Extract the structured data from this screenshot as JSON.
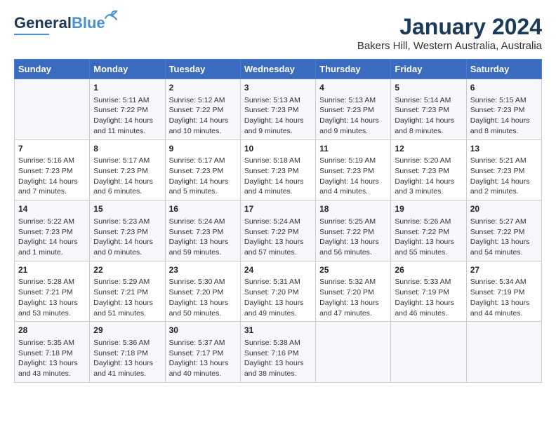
{
  "header": {
    "logo_general": "General",
    "logo_blue": "Blue",
    "main_title": "January 2024",
    "subtitle": "Bakers Hill, Western Australia, Australia"
  },
  "days_of_week": [
    "Sunday",
    "Monday",
    "Tuesday",
    "Wednesday",
    "Thursday",
    "Friday",
    "Saturday"
  ],
  "weeks": [
    [
      {
        "day": "",
        "content": ""
      },
      {
        "day": "1",
        "content": "Sunrise: 5:11 AM\nSunset: 7:22 PM\nDaylight: 14 hours\nand 11 minutes."
      },
      {
        "day": "2",
        "content": "Sunrise: 5:12 AM\nSunset: 7:22 PM\nDaylight: 14 hours\nand 10 minutes."
      },
      {
        "day": "3",
        "content": "Sunrise: 5:13 AM\nSunset: 7:23 PM\nDaylight: 14 hours\nand 9 minutes."
      },
      {
        "day": "4",
        "content": "Sunrise: 5:13 AM\nSunset: 7:23 PM\nDaylight: 14 hours\nand 9 minutes."
      },
      {
        "day": "5",
        "content": "Sunrise: 5:14 AM\nSunset: 7:23 PM\nDaylight: 14 hours\nand 8 minutes."
      },
      {
        "day": "6",
        "content": "Sunrise: 5:15 AM\nSunset: 7:23 PM\nDaylight: 14 hours\nand 8 minutes."
      }
    ],
    [
      {
        "day": "7",
        "content": "Sunrise: 5:16 AM\nSunset: 7:23 PM\nDaylight: 14 hours\nand 7 minutes."
      },
      {
        "day": "8",
        "content": "Sunrise: 5:17 AM\nSunset: 7:23 PM\nDaylight: 14 hours\nand 6 minutes."
      },
      {
        "day": "9",
        "content": "Sunrise: 5:17 AM\nSunset: 7:23 PM\nDaylight: 14 hours\nand 5 minutes."
      },
      {
        "day": "10",
        "content": "Sunrise: 5:18 AM\nSunset: 7:23 PM\nDaylight: 14 hours\nand 4 minutes."
      },
      {
        "day": "11",
        "content": "Sunrise: 5:19 AM\nSunset: 7:23 PM\nDaylight: 14 hours\nand 4 minutes."
      },
      {
        "day": "12",
        "content": "Sunrise: 5:20 AM\nSunset: 7:23 PM\nDaylight: 14 hours\nand 3 minutes."
      },
      {
        "day": "13",
        "content": "Sunrise: 5:21 AM\nSunset: 7:23 PM\nDaylight: 14 hours\nand 2 minutes."
      }
    ],
    [
      {
        "day": "14",
        "content": "Sunrise: 5:22 AM\nSunset: 7:23 PM\nDaylight: 14 hours\nand 1 minute."
      },
      {
        "day": "15",
        "content": "Sunrise: 5:23 AM\nSunset: 7:23 PM\nDaylight: 14 hours\nand 0 minutes."
      },
      {
        "day": "16",
        "content": "Sunrise: 5:24 AM\nSunset: 7:23 PM\nDaylight: 13 hours\nand 59 minutes."
      },
      {
        "day": "17",
        "content": "Sunrise: 5:24 AM\nSunset: 7:22 PM\nDaylight: 13 hours\nand 57 minutes."
      },
      {
        "day": "18",
        "content": "Sunrise: 5:25 AM\nSunset: 7:22 PM\nDaylight: 13 hours\nand 56 minutes."
      },
      {
        "day": "19",
        "content": "Sunrise: 5:26 AM\nSunset: 7:22 PM\nDaylight: 13 hours\nand 55 minutes."
      },
      {
        "day": "20",
        "content": "Sunrise: 5:27 AM\nSunset: 7:22 PM\nDaylight: 13 hours\nand 54 minutes."
      }
    ],
    [
      {
        "day": "21",
        "content": "Sunrise: 5:28 AM\nSunset: 7:21 PM\nDaylight: 13 hours\nand 53 minutes."
      },
      {
        "day": "22",
        "content": "Sunrise: 5:29 AM\nSunset: 7:21 PM\nDaylight: 13 hours\nand 51 minutes."
      },
      {
        "day": "23",
        "content": "Sunrise: 5:30 AM\nSunset: 7:20 PM\nDaylight: 13 hours\nand 50 minutes."
      },
      {
        "day": "24",
        "content": "Sunrise: 5:31 AM\nSunset: 7:20 PM\nDaylight: 13 hours\nand 49 minutes."
      },
      {
        "day": "25",
        "content": "Sunrise: 5:32 AM\nSunset: 7:20 PM\nDaylight: 13 hours\nand 47 minutes."
      },
      {
        "day": "26",
        "content": "Sunrise: 5:33 AM\nSunset: 7:19 PM\nDaylight: 13 hours\nand 46 minutes."
      },
      {
        "day": "27",
        "content": "Sunrise: 5:34 AM\nSunset: 7:19 PM\nDaylight: 13 hours\nand 44 minutes."
      }
    ],
    [
      {
        "day": "28",
        "content": "Sunrise: 5:35 AM\nSunset: 7:18 PM\nDaylight: 13 hours\nand 43 minutes."
      },
      {
        "day": "29",
        "content": "Sunrise: 5:36 AM\nSunset: 7:18 PM\nDaylight: 13 hours\nand 41 minutes."
      },
      {
        "day": "30",
        "content": "Sunrise: 5:37 AM\nSunset: 7:17 PM\nDaylight: 13 hours\nand 40 minutes."
      },
      {
        "day": "31",
        "content": "Sunrise: 5:38 AM\nSunset: 7:16 PM\nDaylight: 13 hours\nand 38 minutes."
      },
      {
        "day": "",
        "content": ""
      },
      {
        "day": "",
        "content": ""
      },
      {
        "day": "",
        "content": ""
      }
    ]
  ]
}
